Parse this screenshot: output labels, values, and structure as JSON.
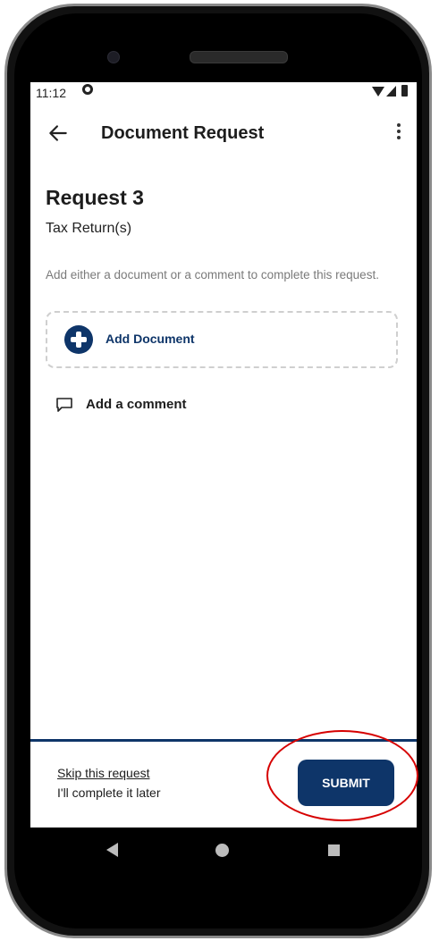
{
  "status_bar": {
    "time": "11:12"
  },
  "app_bar": {
    "title": "Document Request",
    "back_icon": "arrow-left-icon",
    "menu_icon": "more-vertical-icon"
  },
  "request": {
    "title": "Request 3",
    "subtitle": "Tax Return(s)",
    "helper_text": "Add either a document or a comment to complete this request."
  },
  "add_document": {
    "label": "Add Document",
    "icon": "plus-circle-icon"
  },
  "comment": {
    "label": "Add a comment",
    "icon": "comment-icon"
  },
  "footer": {
    "skip_link": "Skip this request",
    "later_text": "I'll complete it later",
    "submit_label": "SUBMIT"
  },
  "colors": {
    "brand": "#0e3569",
    "highlight": "#d60000"
  }
}
